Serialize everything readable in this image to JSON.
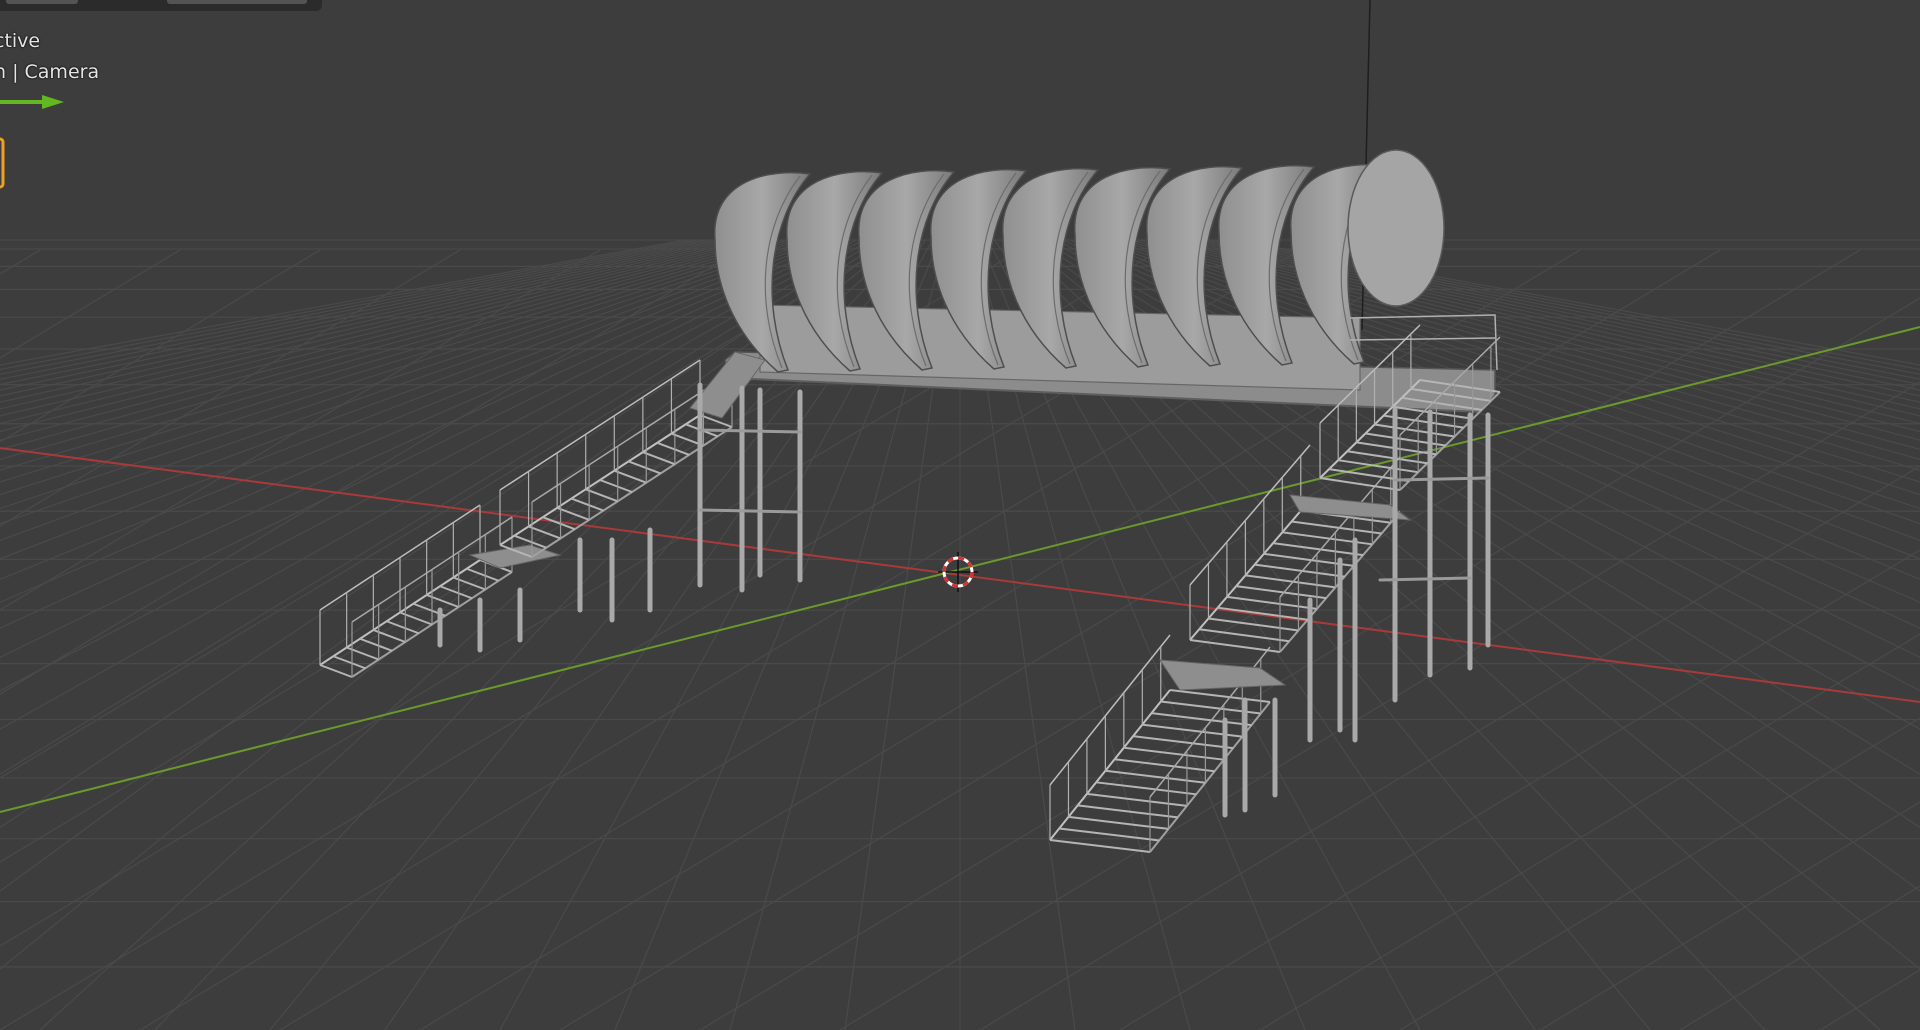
{
  "header": {
    "view_mode": "ctive",
    "view_name": "n | Camera"
  },
  "icons": {
    "nav_arrow": "green-arrow-icon",
    "object": "camera-object-icon",
    "cursor": "3d-cursor-icon"
  },
  "colors": {
    "background": "#3d3d3d",
    "grid": "#4a4a4a",
    "x_axis": "#b23a3a",
    "y_axis": "#6d9a2a",
    "model_light": "#9a9a9a",
    "model_dark": "#5a5a5a",
    "accent_orange": "#f0a020"
  }
}
